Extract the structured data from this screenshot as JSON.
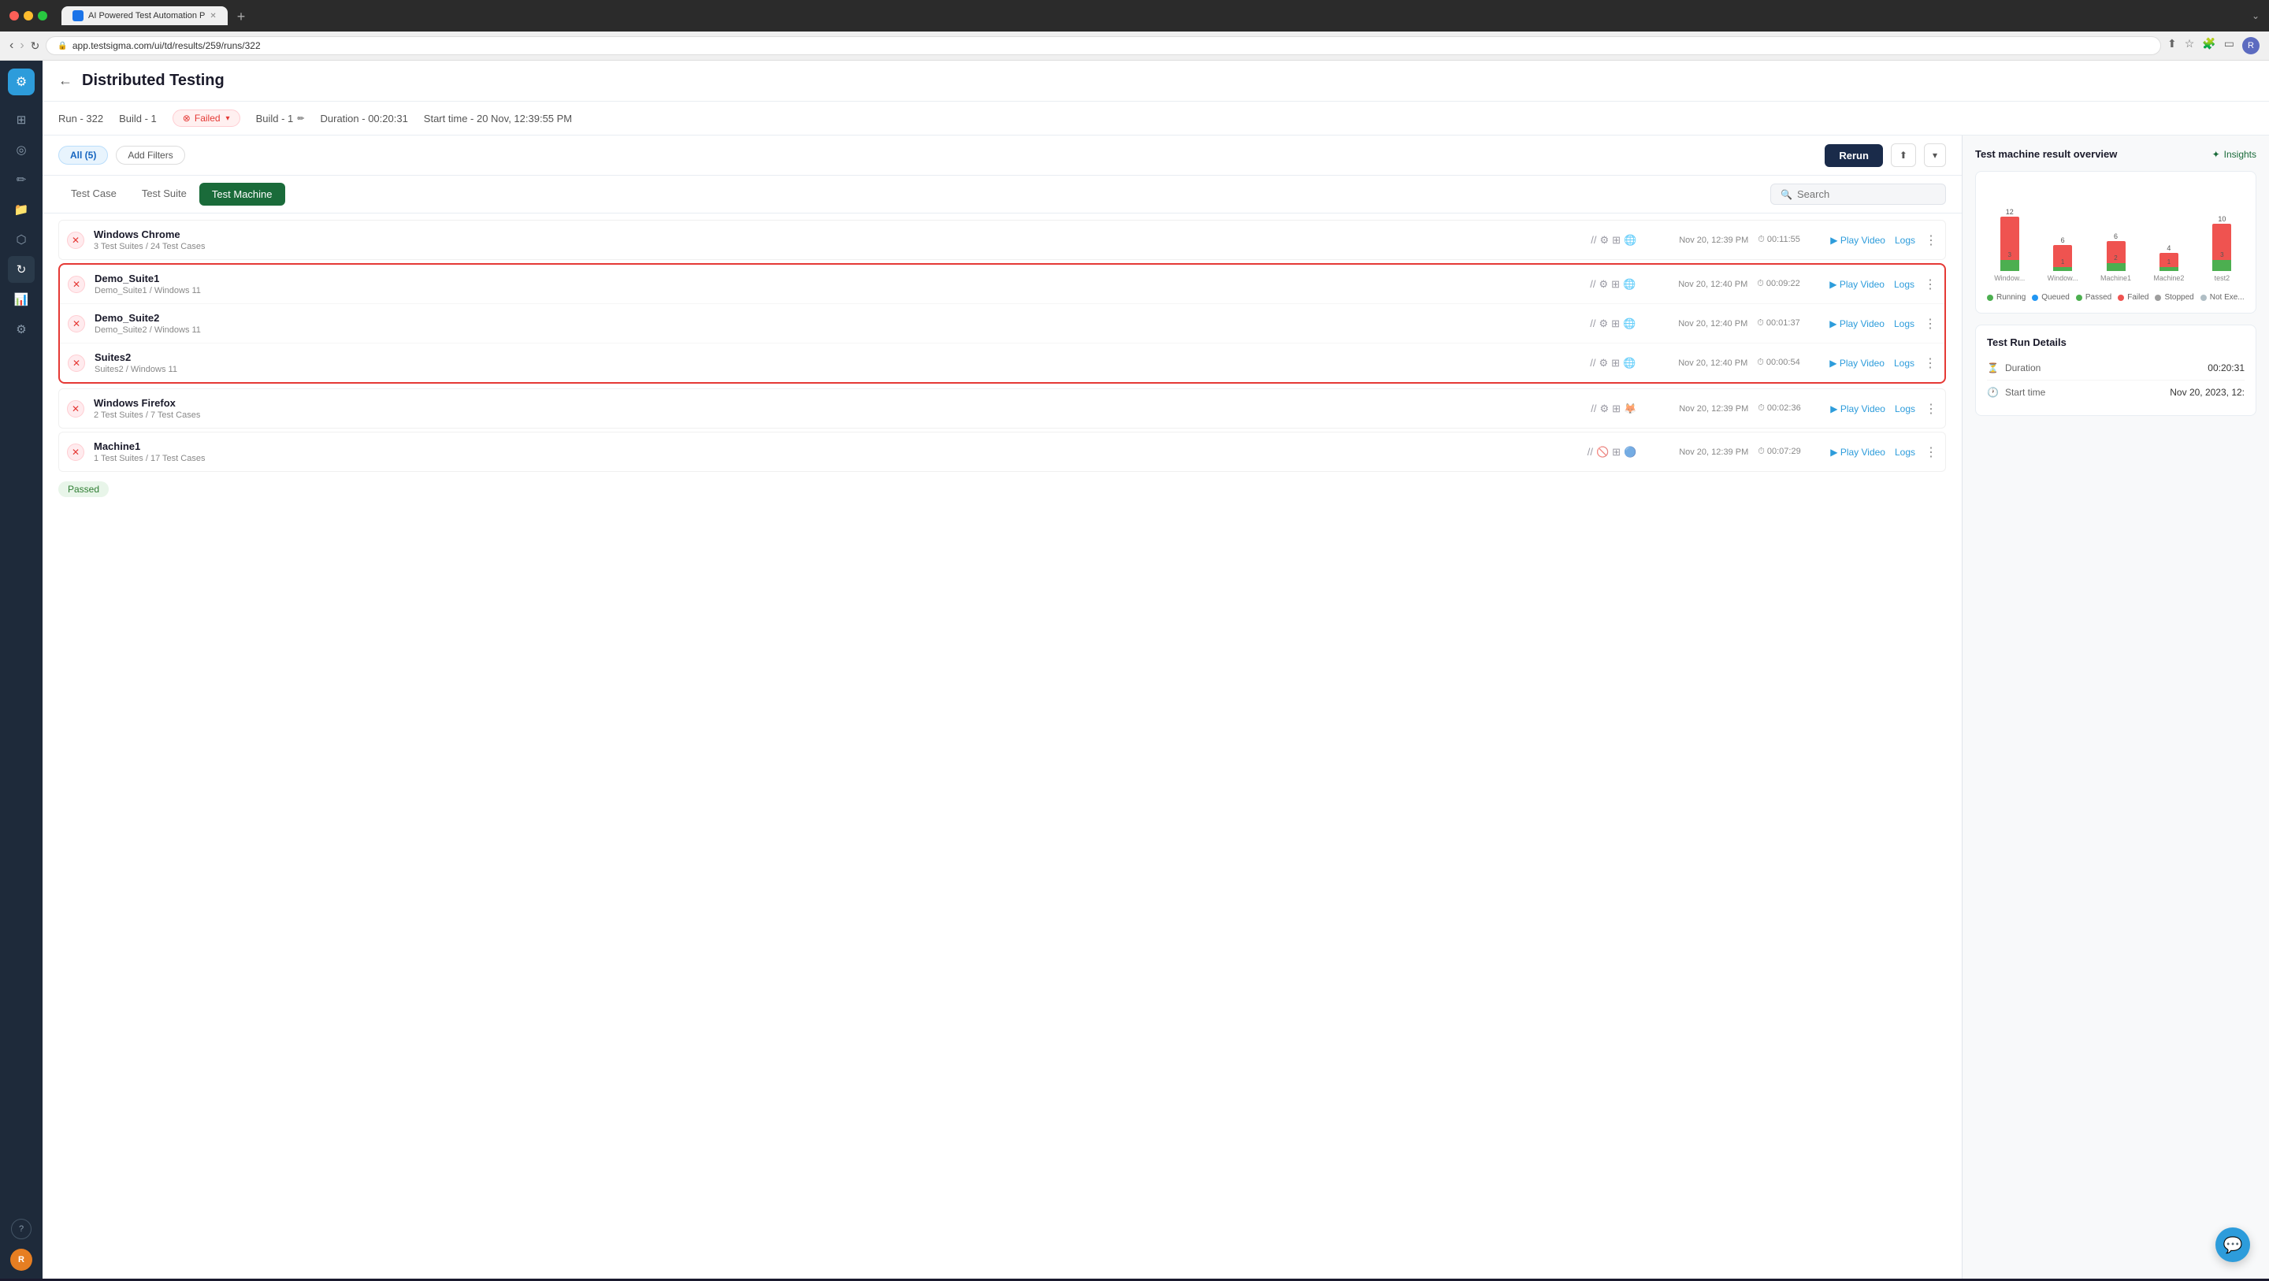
{
  "browser": {
    "url": "app.testsigma.com/ui/td/results/259/runs/322",
    "tab_title": "AI Powered Test Automation P",
    "new_tab_icon": "+"
  },
  "header": {
    "back_label": "←",
    "title": "Distributed Testing"
  },
  "run_info": {
    "run": "Run - 322",
    "build": "Build - 1",
    "status": "Failed",
    "build_edit": "Build - 1",
    "duration": "Duration - 00:20:31",
    "start_time": "Start time - 20 Nov, 12:39:55 PM"
  },
  "filters": {
    "all_label": "All (5)",
    "add_filters": "Add Filters",
    "rerun": "Rerun"
  },
  "tabs": {
    "test_case": "Test Case",
    "test_suite": "Test Suite",
    "test_machine": "Test Machine",
    "search_placeholder": "Search"
  },
  "results": [
    {
      "name": "Windows Chrome",
      "sub": "3 Test Suites / 24 Test Cases",
      "status": "failed",
      "date": "Nov 20, 12:39 PM",
      "duration": "00:11:55",
      "play_video": "Play Video",
      "logs": "Logs"
    },
    {
      "name": "Demo_Suite1",
      "sub": "Demo_Suite1 / Windows 11",
      "status": "failed",
      "date": "Nov 20, 12:40 PM",
      "duration": "00:09:22",
      "play_video": "Play Video",
      "logs": "Logs",
      "expanded": true
    },
    {
      "name": "Demo_Suite2",
      "sub": "Demo_Suite2 / Windows 11",
      "status": "failed",
      "date": "Nov 20, 12:40 PM",
      "duration": "00:01:37",
      "play_video": "Play Video",
      "logs": "Logs",
      "expanded": true
    },
    {
      "name": "Suites2",
      "sub": "Suites2 / Windows 11",
      "status": "failed",
      "date": "Nov 20, 12:40 PM",
      "duration": "00:00:54",
      "play_video": "Play Video",
      "logs": "Logs",
      "expanded": true
    },
    {
      "name": "Windows Firefox",
      "sub": "2 Test Suites / 7 Test Cases",
      "status": "failed",
      "date": "Nov 20, 12:39 PM",
      "duration": "00:02:36",
      "play_video": "Play Video",
      "logs": "Logs"
    },
    {
      "name": "Machine1",
      "sub": "1 Test Suites / 17 Test Cases",
      "status": "failed",
      "date": "Nov 20, 12:39 PM",
      "duration": "00:07:29",
      "play_video": "Play Video",
      "logs": "Logs"
    }
  ],
  "right_panel": {
    "title": "Test machine result overview",
    "insights_label": "Insights",
    "chart": {
      "groups": [
        {
          "label": "Window...",
          "failed": 12,
          "passed": 3
        },
        {
          "label": "Window...",
          "failed": 6,
          "passed": 1
        },
        {
          "label": "Machine1",
          "failed": 6,
          "passed": 2
        },
        {
          "label": "Machine2",
          "failed": 4,
          "passed": 1
        },
        {
          "label": "test2",
          "failed": 10,
          "passed": 3
        }
      ],
      "legend": [
        {
          "label": "Running",
          "color": "#4caf50"
        },
        {
          "label": "Queued",
          "color": "#2196f3"
        },
        {
          "label": "Passed",
          "color": "#4caf50"
        },
        {
          "label": "Failed",
          "color": "#ef5350"
        },
        {
          "label": "Stopped",
          "color": "#9e9e9e"
        },
        {
          "label": "Not Exe...",
          "color": "#b0bec5"
        }
      ]
    },
    "details_title": "Test Run Details",
    "details": [
      {
        "icon": "⏱",
        "label": "Duration",
        "value": "00:20:31"
      },
      {
        "icon": "🕐",
        "label": "Start time",
        "value": "Nov 20, 2023, 12:"
      }
    ]
  },
  "sidebar": {
    "items": [
      {
        "icon": "⊞",
        "label": "dashboard"
      },
      {
        "icon": "◎",
        "label": "results"
      },
      {
        "icon": "✏",
        "label": "edit"
      },
      {
        "icon": "📁",
        "label": "files"
      },
      {
        "icon": "⬡",
        "label": "grid"
      },
      {
        "icon": "↻",
        "label": "runs"
      },
      {
        "icon": "📊",
        "label": "reports"
      },
      {
        "icon": "⚙",
        "label": "settings"
      }
    ],
    "help": "?",
    "avatar": "R"
  },
  "passed_label": "Passed",
  "chat_icon": "💬"
}
